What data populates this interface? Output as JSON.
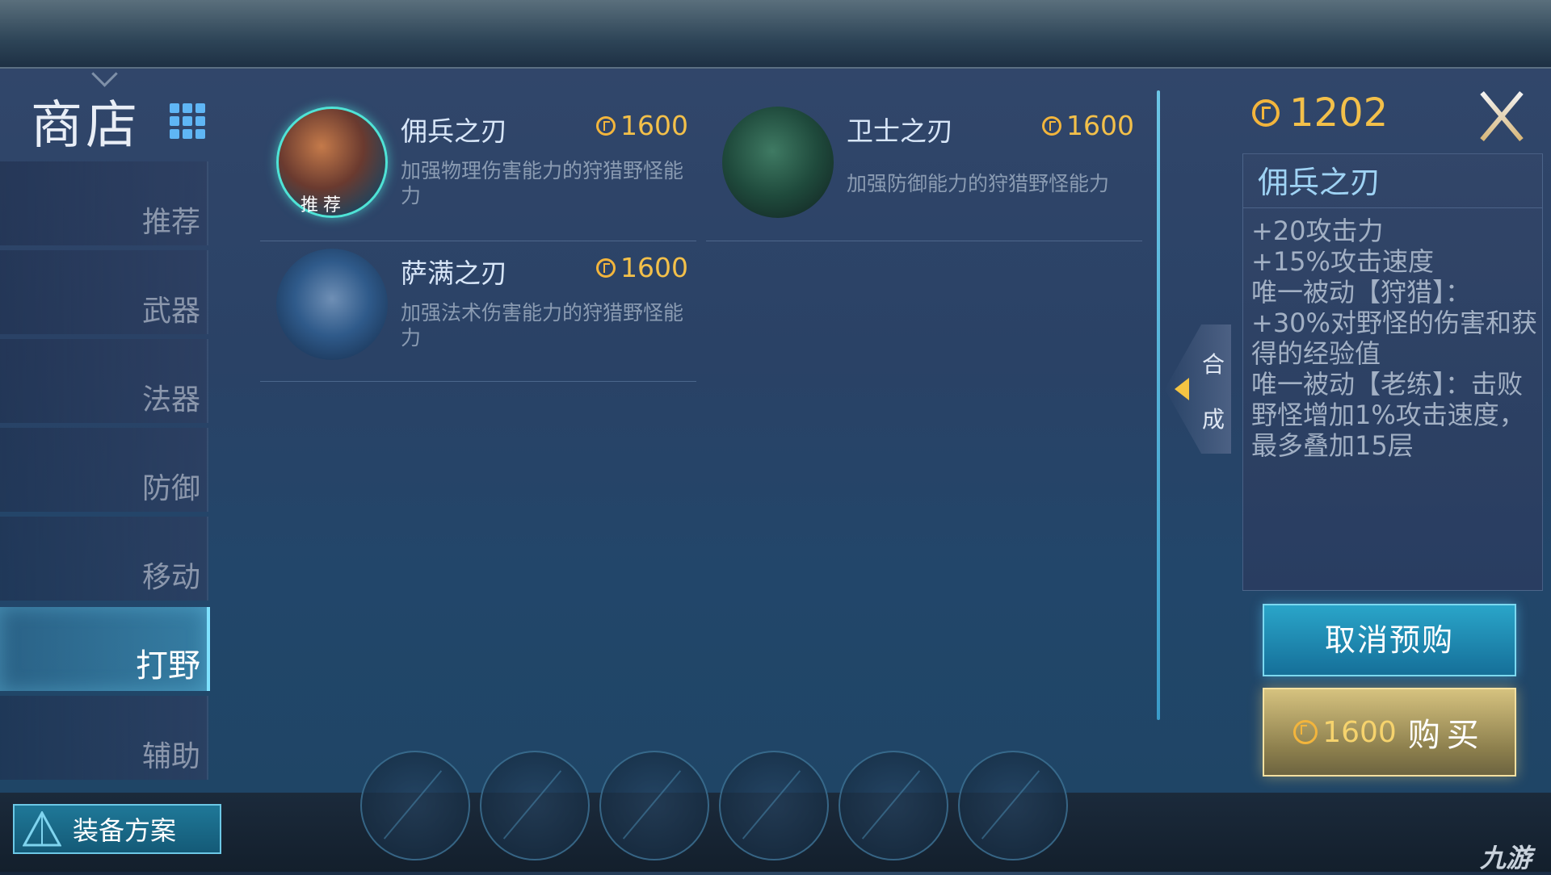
{
  "shop": {
    "title": "商店"
  },
  "categories": [
    {
      "label": "推荐"
    },
    {
      "label": "武器"
    },
    {
      "label": "法器"
    },
    {
      "label": "防御"
    },
    {
      "label": "移动"
    },
    {
      "label": "打野",
      "active": true
    },
    {
      "label": "辅助"
    }
  ],
  "items": [
    {
      "name": "佣兵之刃",
      "price": "1600",
      "desc": "加强物理伤害能力的狩猎野怪能力",
      "badge": "推荐",
      "selected": true
    },
    {
      "name": "卫士之刃",
      "price": "1600",
      "desc": "加强防御能力的狩猎野怪能力"
    },
    {
      "name": "萨满之刃",
      "price": "1600",
      "desc": "加强法术伤害能力的狩猎野怪能力"
    }
  ],
  "craft_tab": {
    "line1": "合",
    "line2": "成"
  },
  "player": {
    "gold": "1202"
  },
  "detail": {
    "name": "佣兵之刃",
    "stats": [
      "+20攻击力",
      "+15%攻击速度",
      "唯一被动【狩猎】：+30%对野怪的伤害和获得的经验值",
      "唯一被动【老练】：击败野怪增加1%攻击速度，最多叠加15层"
    ]
  },
  "buttons": {
    "cancel_preorder": "取消预购",
    "buy_price": "1600",
    "buy_label": "购买"
  },
  "equip_plan": {
    "label": "装备方案"
  },
  "watermark": "九游",
  "colors": {
    "gold": "#f3c04a",
    "accent": "#7fe2ff",
    "title_blue": "#9fd3f4"
  },
  "icons": [
    "grid-icon",
    "coin-icon",
    "close-icon",
    "craft-arrow-icon",
    "equip-plan-icon"
  ]
}
